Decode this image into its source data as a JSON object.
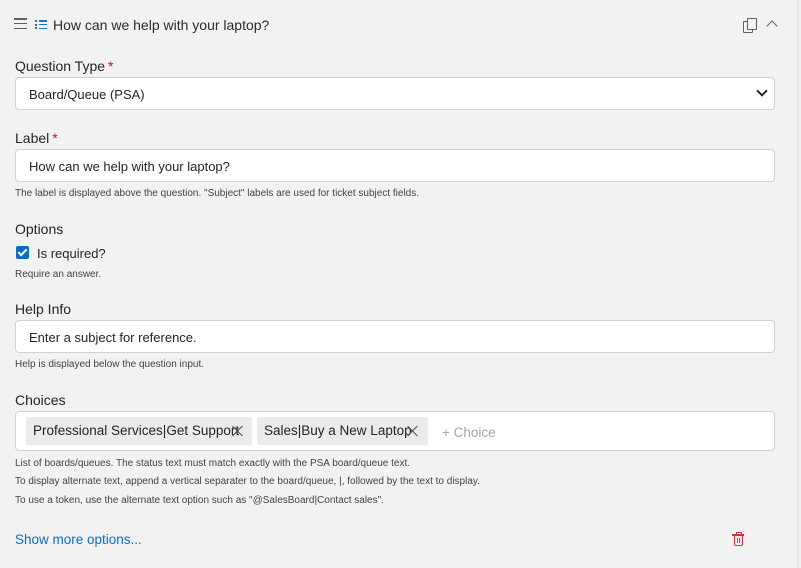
{
  "header": {
    "title": "How can we help with your laptop?",
    "drag_icon": "hamburger-icon",
    "type_icon": "list-icon",
    "copy_icon": "copy-icon",
    "collapse_icon": "chevron-up-icon"
  },
  "question_type": {
    "label": "Question Type",
    "required_mark": "*",
    "selected": "Board/Queue (PSA)"
  },
  "label_field": {
    "label": "Label",
    "required_mark": "*",
    "value": "How can we help with your laptop?",
    "hint": "The label is displayed above the question. \"Subject\" labels are used for ticket subject fields."
  },
  "options": {
    "label": "Options",
    "is_required_label": "Is required?",
    "is_required_checked": true,
    "hint": "Require an answer."
  },
  "help_info": {
    "label": "Help Info",
    "value": "Enter a subject for reference.",
    "hint": "Help is displayed below the question input."
  },
  "choices": {
    "label": "Choices",
    "items": [
      {
        "label": "Professional Services|Get Support"
      },
      {
        "label": "Sales|Buy a New Laptop"
      }
    ],
    "placeholder": "+ Choice",
    "hints": [
      "List of boards/queues. The status text must match exactly with the PSA board/queue text.",
      "To display alternate text, append a vertical separater to the board/queue, |, followed by the text to display.",
      "To use a token, use the alternate text option such as \"@SalesBoard|Contact sales\"."
    ]
  },
  "footer": {
    "show_more": "Show more options...",
    "delete_icon": "trash-icon",
    "accent": "#0f6cbd",
    "danger": "#d13438"
  }
}
